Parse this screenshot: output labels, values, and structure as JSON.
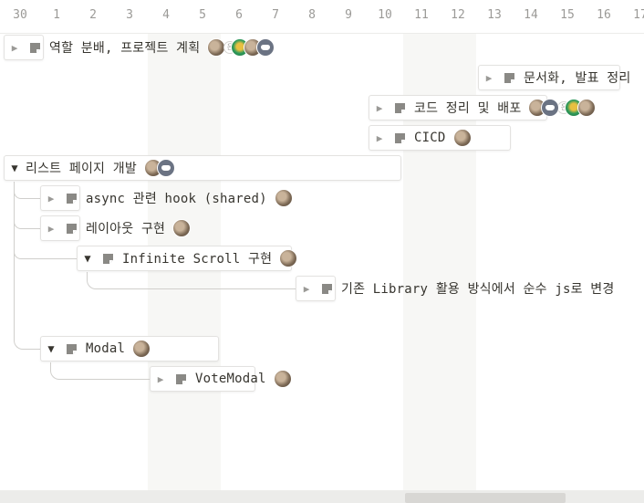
{
  "timeline": {
    "days": [
      "30",
      "1",
      "2",
      "3",
      "4",
      "5",
      "6",
      "7",
      "8",
      "9",
      "10",
      "11",
      "12",
      "13",
      "14",
      "15",
      "16",
      "17"
    ]
  },
  "tasks": [
    {
      "title": "역할 분배, 프로젝트 계획",
      "expanded": false,
      "avatars": [
        "cat",
        "dot",
        "leaf",
        "cat",
        "discord"
      ]
    },
    {
      "title": "문서화, 발표 정리",
      "expanded": false,
      "avatars": []
    },
    {
      "title": "코드 정리 및 배포",
      "expanded": false,
      "avatars": [
        "cat",
        "discord",
        "dot",
        "leaf",
        "cat"
      ]
    },
    {
      "title": "CICD",
      "expanded": false,
      "avatars": [
        "cat"
      ]
    },
    {
      "title": "리스트 페이지 개발",
      "expanded": true,
      "avatars": [
        "cat",
        "discord"
      ]
    },
    {
      "title": "async 관련 hook (shared)",
      "expanded": false,
      "avatars": [
        "cat"
      ]
    },
    {
      "title": "레이아웃 구현",
      "expanded": false,
      "avatars": [
        "cat"
      ]
    },
    {
      "title": "Infinite Scroll 구현",
      "expanded": true,
      "avatars": [
        "cat"
      ]
    },
    {
      "title": "기존 Library 활용 방식에서 순수 js로 변경",
      "expanded": false,
      "avatars": []
    },
    {
      "title": "Modal",
      "expanded": true,
      "avatars": [
        "cat"
      ]
    },
    {
      "title": "VoteModal",
      "expanded": false,
      "avatars": [
        "cat"
      ]
    }
  ],
  "toggle_icons": {
    "collapsed": "▶",
    "expanded": "▼"
  },
  "icons": {
    "page": "page-icon"
  },
  "colors": {
    "weekend": "#f7f7f5",
    "border": "#e3e2e0",
    "text": "#37352f",
    "muted": "#9b9a97"
  }
}
